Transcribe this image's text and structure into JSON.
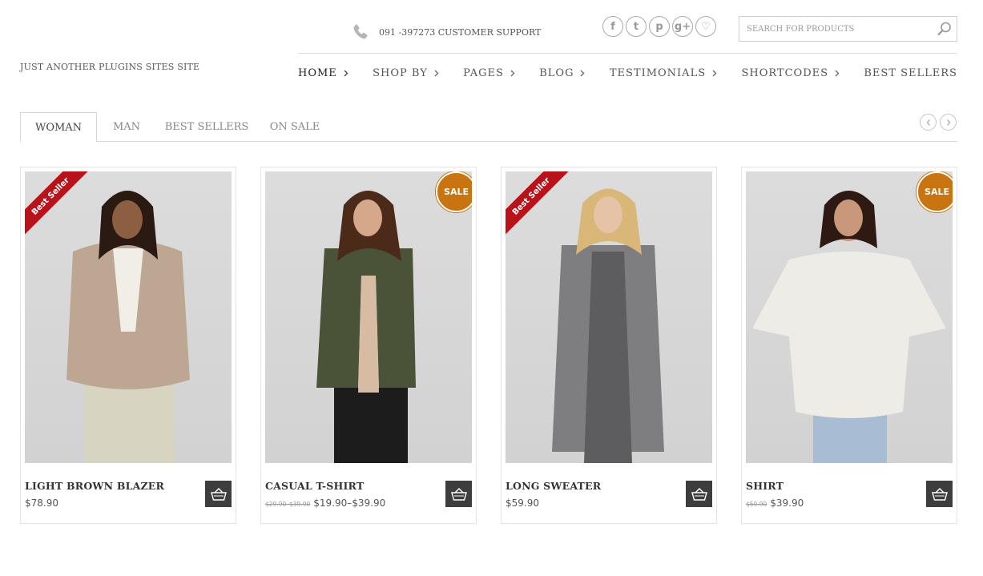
{
  "site": {
    "tagline": "JUST ANOTHER PLUGINS SITES SITE"
  },
  "support": {
    "text": "091 -397273 CUSTOMER SUPPORT",
    "icon": "phone-icon"
  },
  "socials": [
    {
      "label": "f",
      "icon": "facebook-icon"
    },
    {
      "label": "t",
      "icon": "twitter-icon"
    },
    {
      "label": "p",
      "icon": "pinterest-icon"
    },
    {
      "label": "g+",
      "icon": "google-plus-icon"
    },
    {
      "label": "♡",
      "icon": "heart-icon"
    }
  ],
  "search": {
    "placeholder": "SEARCH FOR PRODUCTS",
    "icon": "search-icon"
  },
  "nav": [
    {
      "label": "HOME"
    },
    {
      "label": "SHOP BY"
    },
    {
      "label": "PAGES"
    },
    {
      "label": "BLOG"
    },
    {
      "label": "TESTIMONIALS"
    },
    {
      "label": "SHORTCODES"
    },
    {
      "label": "BEST SELLERS"
    }
  ],
  "tabs": [
    {
      "label": "WOMAN"
    },
    {
      "label": "MAN"
    },
    {
      "label": "BEST SELLERS"
    },
    {
      "label": "ON SALE"
    }
  ],
  "products": [
    {
      "name": "LIGHT BROWN BLAZER",
      "old_price": "",
      "price": "$78.90",
      "badge": "Best Seller",
      "badge_type": "ribbon"
    },
    {
      "name": "CASUAL T-SHIRT",
      "old_price": "$29.90–$39.90",
      "price": "$19.90–$39.90",
      "badge": "SALE",
      "badge_type": "sale"
    },
    {
      "name": "LONG SWEATER",
      "old_price": "",
      "price": "$59.90",
      "badge": "Best Seller",
      "badge_type": "ribbon"
    },
    {
      "name": "SHIRT",
      "old_price": "$59.90",
      "price": "$39.90",
      "badge": "SALE",
      "badge_type": "sale"
    }
  ],
  "colors": {
    "sale": "#c77411",
    "ribbon": "#b8121b",
    "cart": "#3d3d3d"
  }
}
